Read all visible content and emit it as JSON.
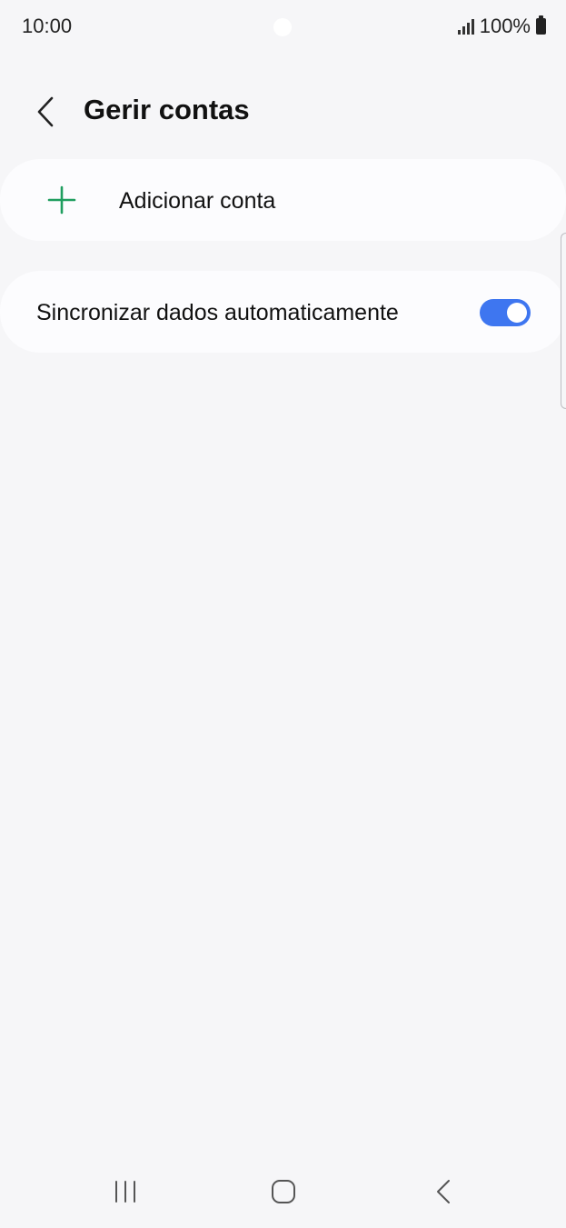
{
  "status_bar": {
    "time": "10:00",
    "battery_text": "100%",
    "icons": [
      "signal-icon",
      "battery-icon"
    ]
  },
  "header": {
    "title": "Gerir contas",
    "back_icon": "chevron-left-icon"
  },
  "add_account": {
    "label": "Adicionar conta",
    "icon": "plus-icon",
    "icon_color": "#1f9e5f"
  },
  "sync": {
    "label": "Sincronizar dados automaticamente",
    "enabled": true,
    "toggle_color": "#3e76f0"
  },
  "nav_bar": {
    "icons": [
      "recents-icon",
      "home-icon",
      "back-icon"
    ]
  }
}
